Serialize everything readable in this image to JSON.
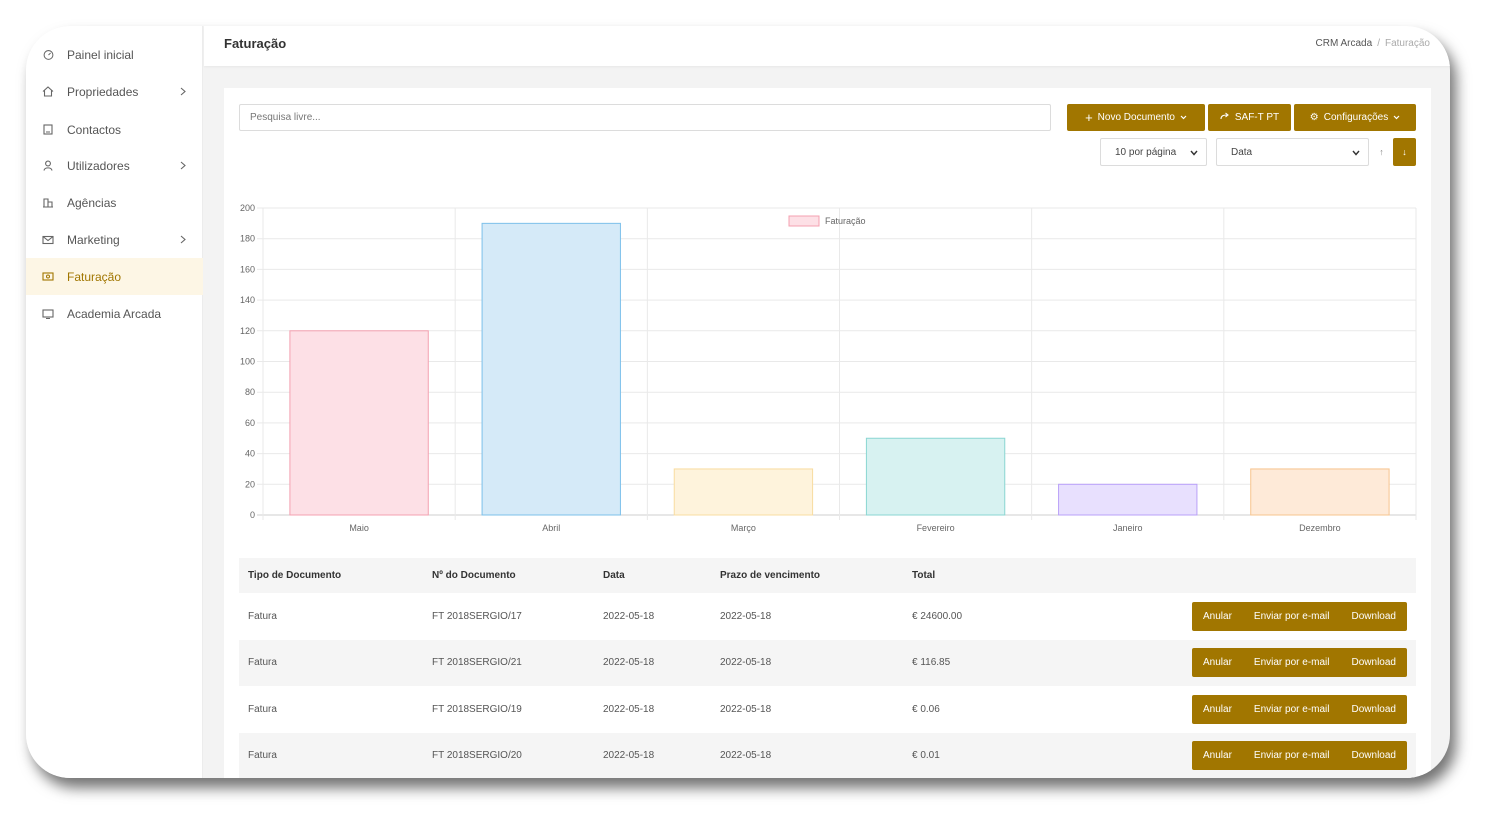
{
  "sidebar": {
    "items": [
      {
        "label": "Painel inicial",
        "icon": "dashboard-icon",
        "has_children": false,
        "active": false
      },
      {
        "label": "Propriedades",
        "icon": "home-icon",
        "has_children": true,
        "active": false
      },
      {
        "label": "Contactos",
        "icon": "contact-card-icon",
        "has_children": false,
        "active": false
      },
      {
        "label": "Utilizadores",
        "icon": "user-icon",
        "has_children": true,
        "active": false
      },
      {
        "label": "Agências",
        "icon": "building-icon",
        "has_children": false,
        "active": false
      },
      {
        "label": "Marketing",
        "icon": "mail-icon",
        "has_children": true,
        "active": false
      },
      {
        "label": "Faturação",
        "icon": "money-icon",
        "has_children": false,
        "active": true
      },
      {
        "label": "Academia Arcada",
        "icon": "book-icon",
        "has_children": false,
        "active": false
      }
    ]
  },
  "header": {
    "title": "Faturação",
    "breadcrumb": [
      "CRM Arcada",
      "Faturação"
    ],
    "breadcrumb_separator": "/"
  },
  "toolbar": {
    "search_placeholder": "Pesquisa livre...",
    "new_document_label": "Novo Documento",
    "saft_label": "SAF-T PT",
    "settings_label": "Configurações",
    "per_page_value": "10 por página",
    "sort_field_value": "Data",
    "sort_asc_glyph": "↑",
    "sort_desc_glyph": "↓"
  },
  "colors": {
    "accent": "#a17600",
    "active_bg": "#fdf6e5"
  },
  "chart_data": {
    "type": "bar",
    "legend": [
      "Faturação"
    ],
    "legend_position": "top",
    "categories": [
      "Maio",
      "Abril",
      "Março",
      "Fevereiro",
      "Janeiro",
      "Dezembro"
    ],
    "series": [
      {
        "name": "Faturação",
        "values": [
          120,
          190,
          30,
          50,
          20,
          30
        ]
      }
    ],
    "bar_fills": [
      "#fde0e6",
      "#d5eaf8",
      "#fef3dc",
      "#d7f2f1",
      "#e8e0fe",
      "#feead8"
    ],
    "bar_strokes": [
      "#f4a0b0",
      "#7cc0ea",
      "#f8dca0",
      "#8ad6d2",
      "#b9a0f8",
      "#f7c48e"
    ],
    "ylim": [
      0,
      200
    ],
    "yticks": [
      0,
      20,
      40,
      60,
      80,
      100,
      120,
      140,
      160,
      180,
      200
    ],
    "grid": true
  },
  "table": {
    "columns": [
      "Tipo de Documento",
      "Nº do Documento",
      "Data",
      "Prazo de vencimento",
      "Total"
    ],
    "rows": [
      {
        "tipo": "Fatura",
        "numero": "FT 2018SERGIO/17",
        "data": "2022-05-18",
        "prazo": "2022-05-18",
        "total": "€ 24600.00"
      },
      {
        "tipo": "Fatura",
        "numero": "FT 2018SERGIO/21",
        "data": "2022-05-18",
        "prazo": "2022-05-18",
        "total": "€ 116.85"
      },
      {
        "tipo": "Fatura",
        "numero": "FT 2018SERGIO/19",
        "data": "2022-05-18",
        "prazo": "2022-05-18",
        "total": "€ 0.06"
      },
      {
        "tipo": "Fatura",
        "numero": "FT 2018SERGIO/20",
        "data": "2022-05-18",
        "prazo": "2022-05-18",
        "total": "€ 0.01"
      }
    ],
    "row_actions": [
      "Anular",
      "Enviar por e-mail",
      "Download"
    ]
  }
}
